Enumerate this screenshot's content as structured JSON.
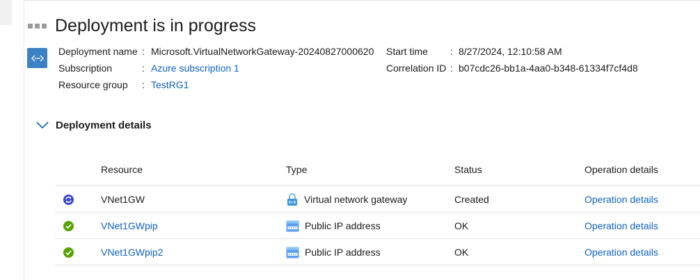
{
  "header": {
    "title": "Deployment is in progress"
  },
  "info": {
    "left": [
      {
        "label": "Deployment name",
        "value": "Microsoft.VirtualNetworkGateway-20240827000620",
        "link": false
      },
      {
        "label": "Subscription",
        "value": "Azure subscription 1",
        "link": true
      },
      {
        "label": "Resource group",
        "value": "TestRG1",
        "link": true
      }
    ],
    "right": [
      {
        "label": "Start time",
        "value": "8/27/2024, 12:10:58 AM"
      },
      {
        "label": "Correlation ID",
        "value": "b07cdc26-bb1a-4aa0-b348-61334f7cf4d8"
      }
    ],
    "colon": ":"
  },
  "details": {
    "title": "Deployment details",
    "columns": {
      "resource": "Resource",
      "type": "Type",
      "status": "Status",
      "operation": "Operation details"
    },
    "rows": [
      {
        "status_icon": "in-progress-icon",
        "resource": "VNet1GW",
        "resource_link": false,
        "type_icon": "virtual-network-gateway-icon",
        "type": "Virtual network gateway",
        "status": "Created",
        "operation": "Operation details"
      },
      {
        "status_icon": "success-check-icon",
        "resource": "VNet1GWpip",
        "resource_link": true,
        "type_icon": "public-ip-icon",
        "type": "Public IP address",
        "status": "OK",
        "operation": "Operation details"
      },
      {
        "status_icon": "success-check-icon",
        "resource": "VNet1GWpip2",
        "resource_link": true,
        "type_icon": "public-ip-icon",
        "type": "Public IP address",
        "status": "OK",
        "operation": "Operation details"
      }
    ]
  },
  "colors": {
    "link": "#0f62c0",
    "success": "#57a300",
    "progress": "#3a49c8",
    "deploy_icon_bg": "#3b82c4"
  }
}
